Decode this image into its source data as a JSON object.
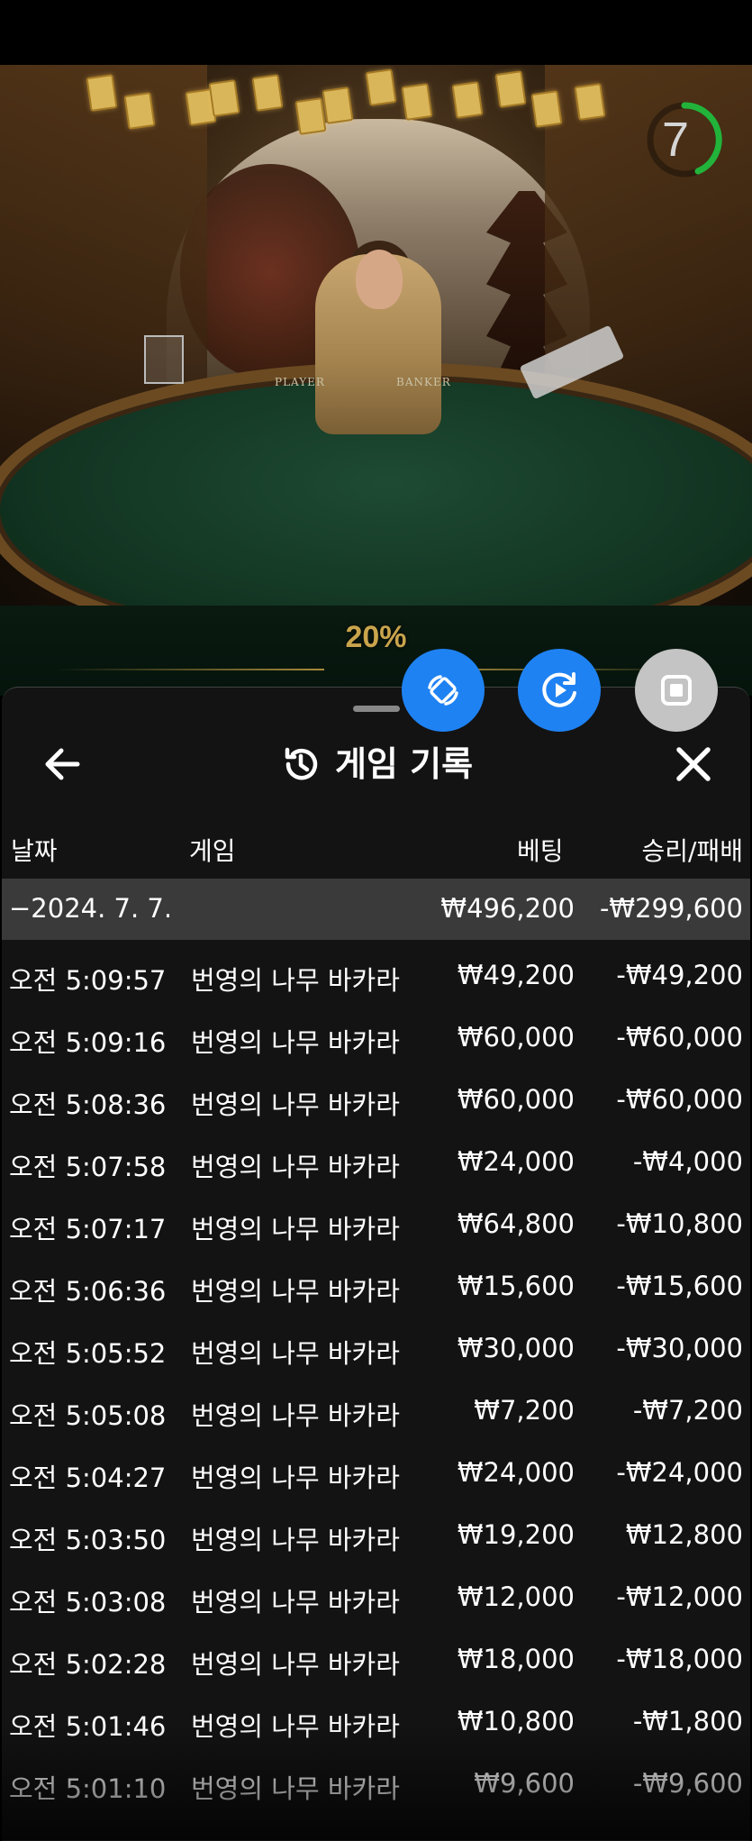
{
  "stream": {
    "timer_value": "7",
    "promo_percent": "20%",
    "table_player_label": "PLAYER",
    "table_banker_label": "BANKER"
  },
  "history": {
    "title": "게임 기록",
    "columns": {
      "date": "날짜",
      "game": "게임",
      "bet": "베팅",
      "result": "승리/패배"
    },
    "day_summary": {
      "date": "−2024. 7. 7.",
      "bet": "₩496,200",
      "result": "-₩299,600"
    },
    "rows": [
      {
        "time": "오전 5:09:57",
        "game": "번영의 나무 바카라",
        "bet": "₩49,200",
        "result": "-₩49,200"
      },
      {
        "time": "오전 5:09:16",
        "game": "번영의 나무 바카라",
        "bet": "₩60,000",
        "result": "-₩60,000"
      },
      {
        "time": "오전 5:08:36",
        "game": "번영의 나무 바카라",
        "bet": "₩60,000",
        "result": "-₩60,000"
      },
      {
        "time": "오전 5:07:58",
        "game": "번영의 나무 바카라",
        "bet": "₩24,000",
        "result": "-₩4,000"
      },
      {
        "time": "오전 5:07:17",
        "game": "번영의 나무 바카라",
        "bet": "₩64,800",
        "result": "-₩10,800"
      },
      {
        "time": "오전 5:06:36",
        "game": "번영의 나무 바카라",
        "bet": "₩15,600",
        "result": "-₩15,600"
      },
      {
        "time": "오전 5:05:52",
        "game": "번영의 나무 바카라",
        "bet": "₩30,000",
        "result": "-₩30,000"
      },
      {
        "time": "오전 5:05:08",
        "game": "번영의 나무 바카라",
        "bet": "₩7,200",
        "result": "-₩7,200"
      },
      {
        "time": "오전 5:04:27",
        "game": "번영의 나무 바카라",
        "bet": "₩24,000",
        "result": "-₩24,000"
      },
      {
        "time": "오전 5:03:50",
        "game": "번영의 나무 바카라",
        "bet": "₩19,200",
        "result": "₩12,800"
      },
      {
        "time": "오전 5:03:08",
        "game": "번영의 나무 바카라",
        "bet": "₩12,000",
        "result": "-₩12,000"
      },
      {
        "time": "오전 5:02:28",
        "game": "번영의 나무 바카라",
        "bet": "₩18,000",
        "result": "-₩18,000"
      },
      {
        "time": "오전 5:01:46",
        "game": "번영의 나무 바카라",
        "bet": "₩10,800",
        "result": "-₩1,800"
      },
      {
        "time": "오전 5:01:10",
        "game": "번영의 나무 바카라",
        "bet": "₩9,600",
        "result": "-₩9,600"
      }
    ]
  },
  "colors": {
    "fab_blue": "#1f82f3",
    "fab_gray": "#c4c4c4",
    "timer_ring": "#22b33a",
    "promo_gold": "#c9a44c"
  },
  "icons": {
    "back": "arrow-left-icon",
    "history": "history-icon",
    "close": "close-icon",
    "rotate": "rotate-icon",
    "replay": "replay-icon",
    "stop": "stop-icon"
  }
}
